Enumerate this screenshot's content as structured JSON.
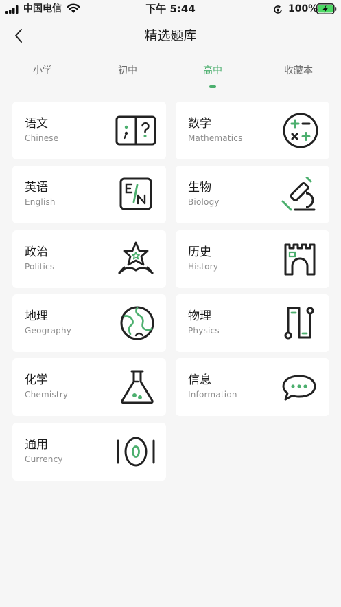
{
  "status_bar": {
    "carrier": "中国电信",
    "time": "下午 5:44",
    "battery_percent": "100%",
    "icons": [
      "signal-icon",
      "wifi-icon",
      "orientation-lock-icon",
      "battery-charging-icon"
    ]
  },
  "nav": {
    "title": "精选题库",
    "back_icon": "chevron-left-icon"
  },
  "tabs": [
    {
      "label": "小学",
      "active": false
    },
    {
      "label": "初中",
      "active": false
    },
    {
      "label": "高中",
      "active": true
    },
    {
      "label": "收藏本",
      "active": false
    }
  ],
  "accent_color": "#4caf6e",
  "subjects": [
    {
      "cn": "语文",
      "en": "Chinese",
      "icon": "book-icon"
    },
    {
      "cn": "数学",
      "en": "Mathematics",
      "icon": "math-operators-icon"
    },
    {
      "cn": "英语",
      "en": "English",
      "icon": "english-card-icon"
    },
    {
      "cn": "生物",
      "en": "Biology",
      "icon": "microscope-icon"
    },
    {
      "cn": "政治",
      "en": "Politics",
      "icon": "star-emblem-icon"
    },
    {
      "cn": "历史",
      "en": "History",
      "icon": "castle-gate-icon"
    },
    {
      "cn": "地理",
      "en": "Geography",
      "icon": "globe-icon"
    },
    {
      "cn": "物理",
      "en": "Physics",
      "icon": "circuit-icon"
    },
    {
      "cn": "化学",
      "en": "Chemistry",
      "icon": "flask-icon"
    },
    {
      "cn": "信息",
      "en": "Information",
      "icon": "chat-bubble-icon"
    },
    {
      "cn": "通用",
      "en": "Currency",
      "icon": "coin-icon"
    }
  ]
}
